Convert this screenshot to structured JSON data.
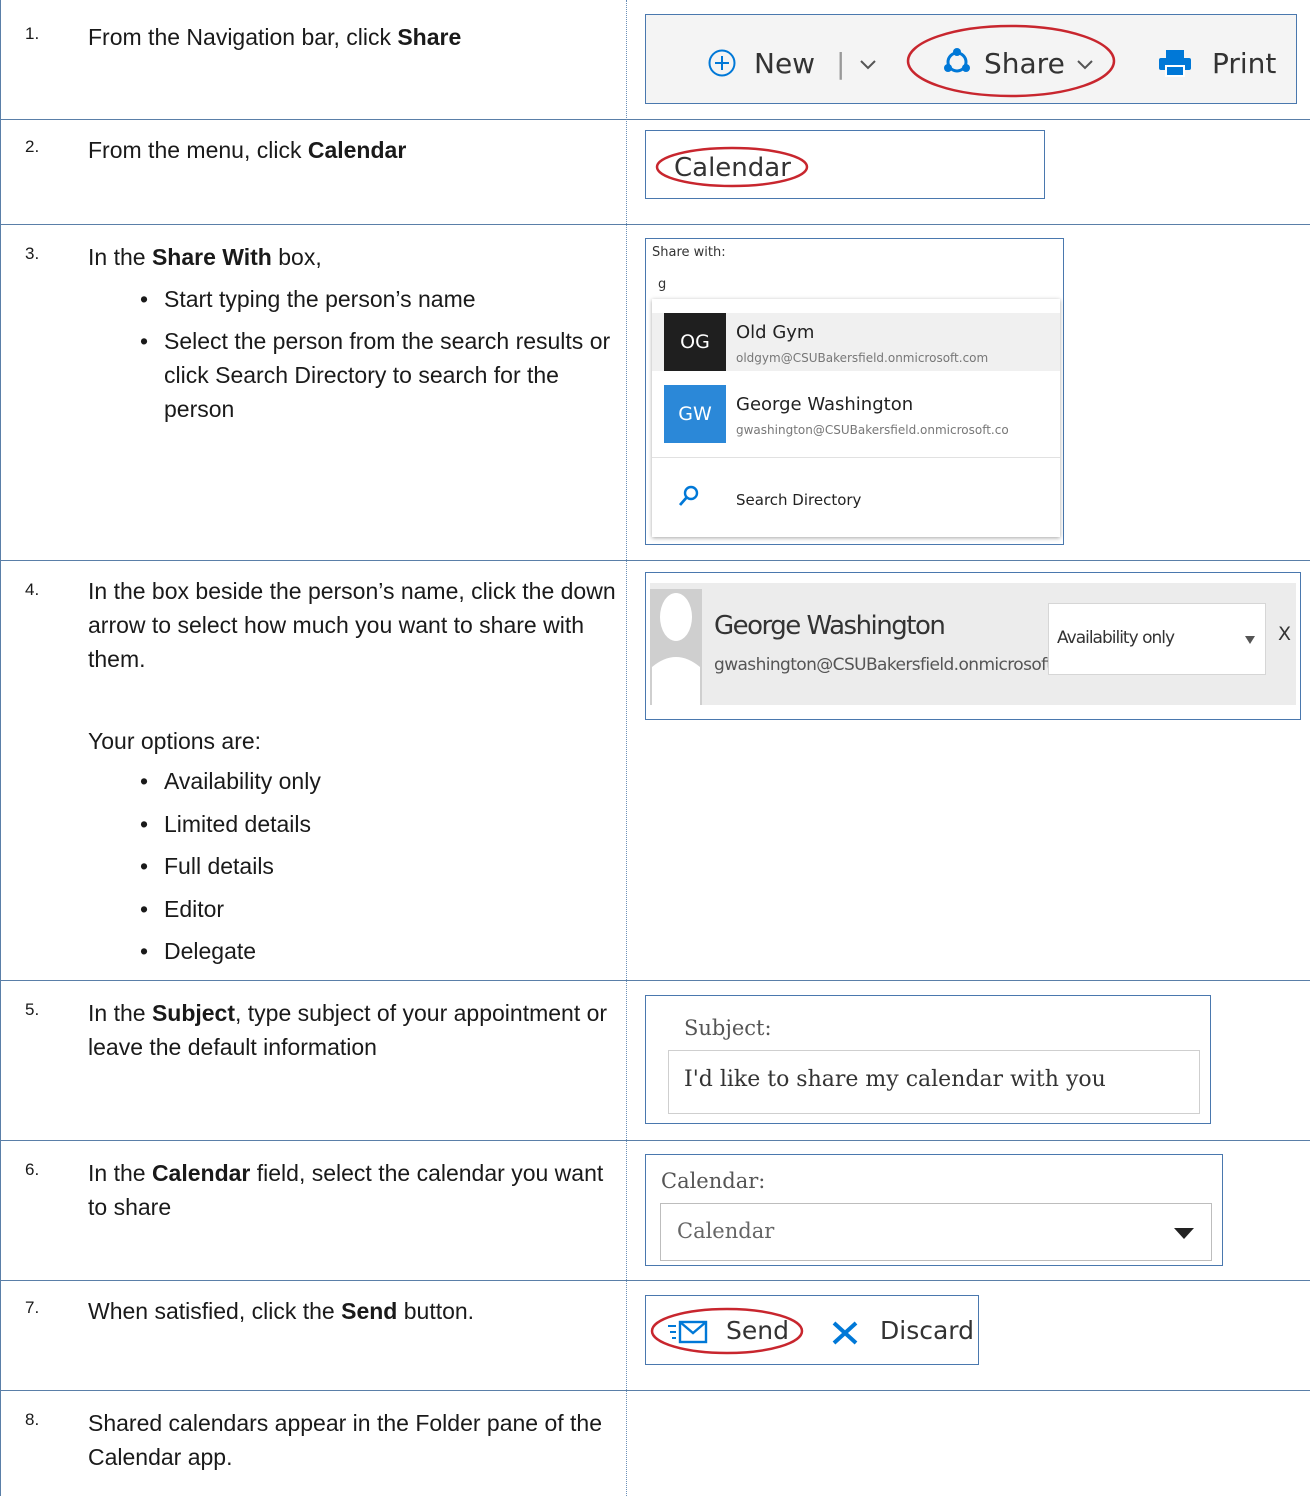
{
  "steps": [
    {
      "num": "1.",
      "pre": "From the Navigation bar, click ",
      "bold": "Share",
      "post": ""
    },
    {
      "num": "2.",
      "pre": "From the menu, click ",
      "bold": "Calendar",
      "post": ""
    },
    {
      "num": "3.",
      "pre": "In the ",
      "bold": "Share With",
      "post": " box,",
      "bullets": [
        "Start typing the person’s name",
        "Select the person from the search results or click Search Directory to search for the person"
      ]
    },
    {
      "num": "4.",
      "text": "In the box beside the person’s name, click the down arrow to select how much you want to share with them.",
      "options_intro": "Your options are:",
      "options": [
        "Availability only",
        "Limited details",
        "Full details",
        "Editor",
        "Delegate"
      ]
    },
    {
      "num": "5.",
      "pre": "In the ",
      "bold": "Subject",
      "post": ", type subject of your appointment or leave the default information"
    },
    {
      "num": "6.",
      "pre": "In the ",
      "bold": "Calendar",
      "post": " field, select the calendar you want to share"
    },
    {
      "num": "7.",
      "pre": "When satisfied, click the ",
      "bold": "Send",
      "post": " button."
    },
    {
      "num": "8.",
      "text": "Shared calendars appear in the Folder pane of the Calendar app."
    }
  ],
  "toolbar": {
    "new_label": "New",
    "separator": "|",
    "share_label": "Share",
    "print_label": "Print"
  },
  "menu": {
    "calendar_label": "Calendar"
  },
  "share_with": {
    "label": "Share with:",
    "input_value": "g",
    "results": [
      {
        "initials": "OG",
        "name": "Old Gym",
        "email": "oldgym@CSUBakersfield.onmicrosoft.com",
        "color": "#1f1f1f"
      },
      {
        "initials": "GW",
        "name": "George Washington",
        "email": "gwashington@CSUBakersfield.onmicrosoft.co",
        "color": "#2b88d8"
      }
    ],
    "search_directory": "Search Directory"
  },
  "permission_row": {
    "name": "George Washington",
    "email": "gwashington@CSUBakersfield.onmicrosoft.com",
    "permission": "Availability only",
    "remove": "X"
  },
  "subject_field": {
    "label": "Subject:",
    "value": "I'd like to share my calendar with you"
  },
  "calendar_field": {
    "label": "Calendar:",
    "value": "Calendar"
  },
  "send_bar": {
    "send_label": "Send",
    "discard_label": "Discard"
  },
  "colors": {
    "accent": "#0078d7",
    "highlight_circle": "#c8262e",
    "frame_border": "#4a78ae"
  }
}
